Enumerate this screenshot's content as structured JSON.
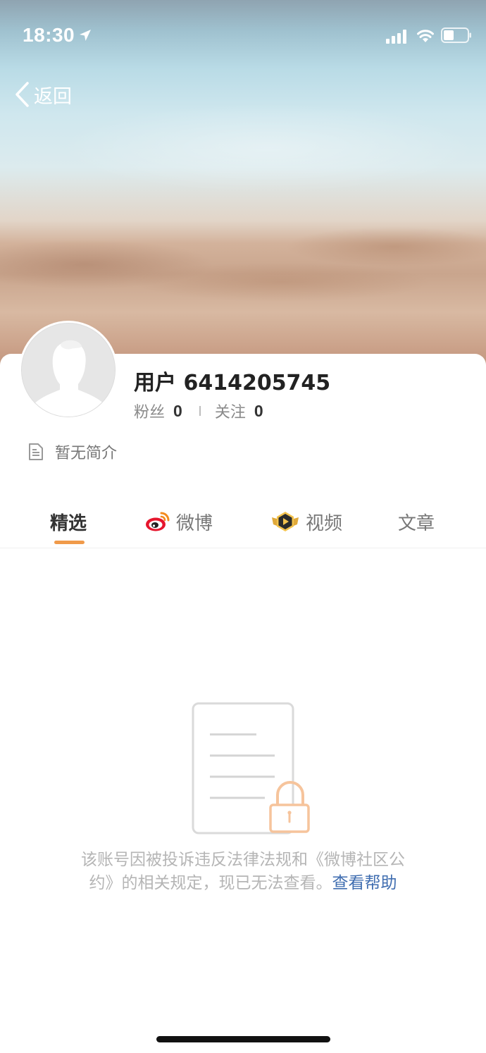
{
  "status_bar": {
    "time": "18:30"
  },
  "nav": {
    "back_label": "返回"
  },
  "profile": {
    "username": "用户 6414205745",
    "followers_label": "粉丝",
    "followers_count": "0",
    "following_label": "关注",
    "following_count": "0",
    "bio": "暂无简介"
  },
  "tabs": [
    {
      "label": "精选",
      "active": true
    },
    {
      "label": "微博",
      "icon": "weibo-logo-icon"
    },
    {
      "label": "视频",
      "icon": "video-badge-icon"
    },
    {
      "label": "文章"
    }
  ],
  "blocked_notice": {
    "line1": "该账号因被投诉违反法律法规和《微博社区公",
    "line2_prefix": "约》的相关规定，现已无法查看。",
    "help_link": "查看帮助"
  },
  "colors": {
    "accent": "#f09a4a",
    "link": "#3f6db0"
  }
}
